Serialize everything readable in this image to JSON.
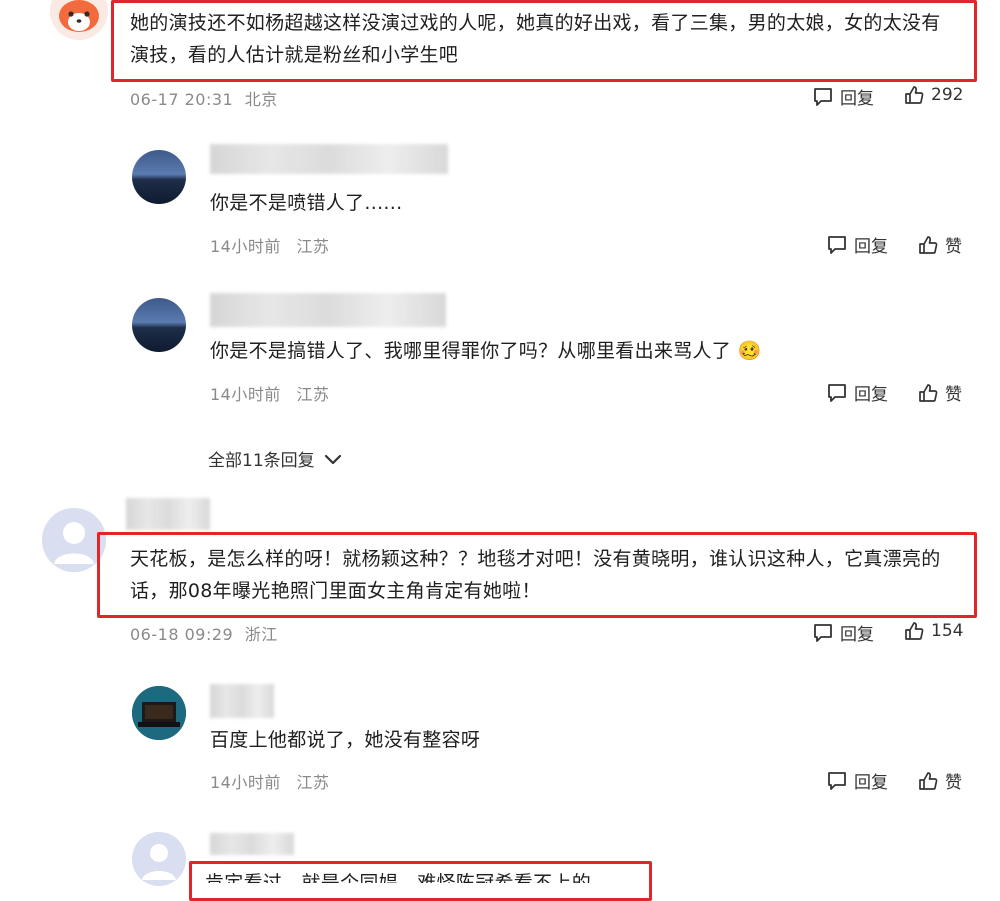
{
  "comments": [
    {
      "text": "她的演技还不如杨超越这样没演过戏的人呢，她真的好出戏，看了三集，男的太娘，女的太没有演技，看的人估计就是粉丝和小学生吧",
      "line1": "她的演技还不如杨超越这样没演过戏的人呢，她真的好出戏，看了三集，男的太娘，女的太没有",
      "line2": "演技，看的人估计就是粉丝和小学生吧",
      "date": "06-17 20:31",
      "location": "北京",
      "reply_label": "回复",
      "likes": "292"
    },
    {
      "text": "天花板，是怎么样的呀！就杨颖这种？？地毯才对吧！没有黄晓明，谁认识这种人，它真漂亮的话，那08年曝光艳照门里面女主角肯定有她啦！",
      "line1": "天花板，是怎么样的呀！就杨颖这种？？地毯才对吧！没有黄晓明，谁认识这种人，它真漂亮的",
      "line2": "话，那08年曝光艳照门里面女主角肯定有她啦！",
      "date": "06-18 09:29",
      "location": "浙江",
      "reply_label": "回复",
      "likes": "154"
    },
    {
      "partial_text": "肯定看过，就是个同娼，难怪陈冠希看不上的"
    }
  ],
  "replies": [
    {
      "text": "你是不是喷错人了......",
      "time": "14小时前",
      "location": "江苏",
      "reply_label": "回复",
      "like_label": "赞"
    },
    {
      "text": "你是不是搞错人了、我哪里得罪你了吗？从哪里看出来骂人了",
      "emoji": "🥴",
      "time": "14小时前",
      "location": "江苏",
      "reply_label": "回复",
      "like_label": "赞"
    },
    {
      "text": "百度上他都说了，她没有整容呀",
      "time": "14小时前",
      "location": "江苏",
      "reply_label": "回复",
      "like_label": "赞"
    }
  ],
  "show_all": "全部11条回复",
  "colors": {
    "highlight_box": "#e0262b",
    "meta": "#8a8a8a"
  },
  "icons": {
    "reply": "comment-bubble-icon",
    "like": "thumbs-up-icon",
    "expand": "chevron-down-icon"
  }
}
